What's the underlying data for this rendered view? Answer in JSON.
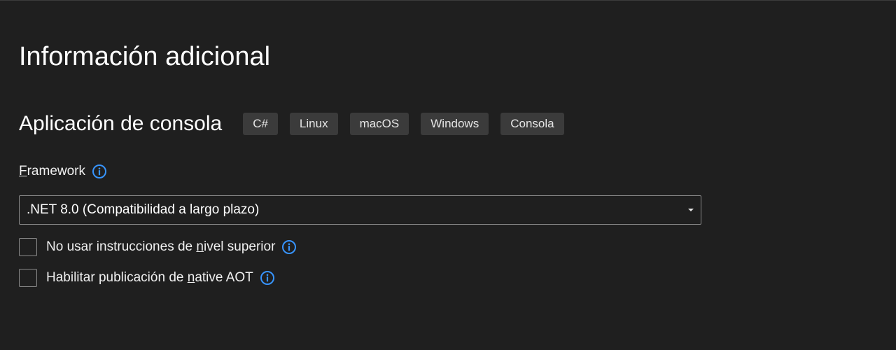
{
  "header": {
    "title": "Información adicional"
  },
  "template": {
    "name": "Aplicación de consola",
    "tags": [
      "C#",
      "Linux",
      "macOS",
      "Windows",
      "Consola"
    ]
  },
  "framework": {
    "label_first_char": "F",
    "label_rest": "ramework",
    "selected": ".NET 8.0 (Compatibilidad a largo plazo)",
    "info_icon": "info-icon"
  },
  "options": {
    "top_level_statements": {
      "label_before": "No usar instrucciones de ",
      "label_underlined": "n",
      "label_after": "ivel superior",
      "checked": false
    },
    "native_aot": {
      "label_before": "Habilitar publicación de ",
      "label_underlined": "n",
      "label_after": "ative AOT",
      "checked": false
    }
  },
  "colors": {
    "background": "#1f1f1f",
    "tag_background": "#3b3b3b",
    "info_icon": "#3794ff",
    "border": "#8a8a8a"
  }
}
